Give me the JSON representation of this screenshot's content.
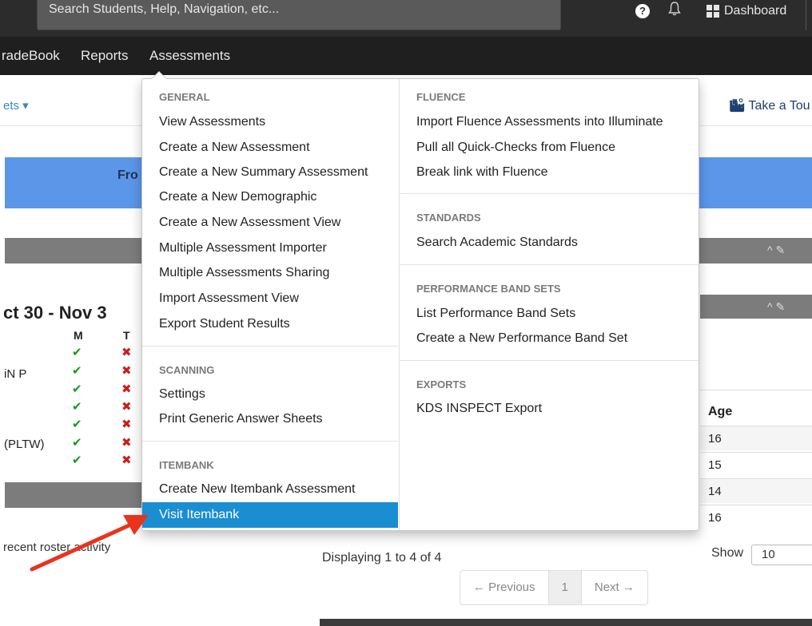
{
  "topbar": {
    "search_placeholder": "Search Students, Help, Navigation, etc...",
    "help_glyph": "?",
    "bell_glyph": "🔔",
    "dashboard_label": "Dashboard"
  },
  "navbar": {
    "items": [
      {
        "label": "radeBook"
      },
      {
        "label": "Reports"
      },
      {
        "label": "Assessments"
      }
    ]
  },
  "page": {
    "sheets_link": "ets ▾",
    "take_tour": "Take a Tou",
    "tour_icon": "binoculars-icon",
    "banner_text": "Fro",
    "week_title": "ct 30 - Nov 3",
    "day_m": "M",
    "day_t": "T",
    "row_a": "iN P",
    "row_b": "(PLTW)",
    "check_glyph": "✔",
    "cross_glyph": "✖",
    "recent_text": "recent roster activity",
    "age_header": "Age",
    "ages": [
      "16",
      "15",
      "14",
      "16"
    ],
    "displaying": "Displaying 1 to 4 of 4",
    "show_label": "Show",
    "show_value": "10",
    "pager_prev": "← Previous",
    "pager_page": "1",
    "pager_next": "Next →",
    "panel_controls": "^ ✎"
  },
  "menu": {
    "general_head": "GENERAL",
    "general": [
      "View Assessments",
      "Create a New Assessment",
      "Create a New Summary Assessment",
      "Create a New Demographic",
      "Create a New Assessment View",
      "Multiple Assessment Importer",
      "Multiple Assessments Sharing",
      "Import Assessment View",
      "Export Student Results"
    ],
    "scanning_head": "SCANNING",
    "scanning": [
      "Settings",
      "Print Generic Answer Sheets"
    ],
    "itembank_head": "ITEMBANK",
    "itembank": [
      "Create New Itembank Assessment",
      "Visit Itembank"
    ],
    "fluence_head": "FLUENCE",
    "fluence": [
      "Import Fluence Assessments into Illuminate",
      "Pull all Quick-Checks from Fluence",
      "Break link with Fluence"
    ],
    "standards_head": "STANDARDS",
    "standards": [
      "Search Academic Standards"
    ],
    "bands_head": "PERFORMANCE BAND SETS",
    "bands": [
      "List Performance Band Sets",
      "Create a New Performance Band Set"
    ],
    "exports_head": "EXPORTS",
    "exports": [
      "KDS INSPECT Export"
    ]
  },
  "colors": {
    "highlight": "#1b8dd1",
    "banner": "#5b96e8",
    "arrow": "#e8341c"
  }
}
